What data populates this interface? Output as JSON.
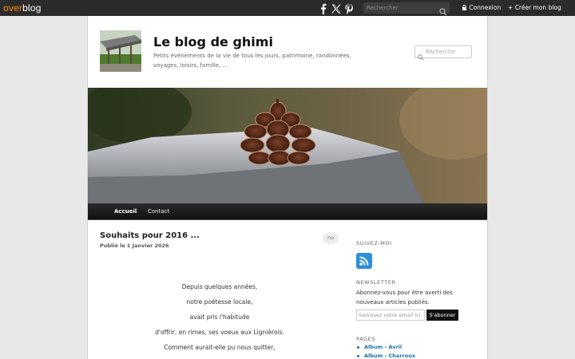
{
  "topbar": {
    "logo_over": "over",
    "logo_blog": "blog",
    "search_placeholder": "Rechercher",
    "login_label": "Connexion",
    "create_label": "Créer mon blog",
    "social_icons": [
      "facebook-icon",
      "x-icon",
      "pinterest-icon"
    ]
  },
  "header": {
    "title": "Le blog de ghimi",
    "description": "Petits événements de la vie de tous les jours, patrimoine, randonnées, voyages, loisirs, famille, ...",
    "search_placeholder": "Recherche"
  },
  "nav": {
    "items": [
      {
        "label": "Accueil",
        "active": true
      },
      {
        "label": "Contact",
        "active": false
      }
    ]
  },
  "post": {
    "title": "Souhaits pour 2016 ...",
    "published_prefix": "Publié le",
    "published_date": "1 Janvier 2026",
    "comments_badge": "no",
    "lines": [
      "Depuis quelques années,",
      "notre poétesse locale,",
      "avait pris l'habitude",
      "d'offrir, en rimes, ses voeux aux Lignièrois.",
      "Comment aurait-elle pu nous quitter,"
    ]
  },
  "sidebar": {
    "follow_heading": "SUIVEZ-MOI",
    "newsletter_heading": "NEWSLETTER",
    "newsletter_text": "Abonnez-vous pour être averti des nouveaux articles publiés.",
    "email_placeholder": "Saisissez votre email ici",
    "subscribe_label": "S'abonner",
    "pages_heading": "PAGES",
    "pages": [
      "Album - Avril",
      "Album - Charroux"
    ]
  },
  "colors": {
    "topbar_bg": "#2b2b2b",
    "logo_accent": "#ff8a00",
    "link_blue": "#1a6fa8",
    "rss_blue": "#2f8fd8"
  }
}
